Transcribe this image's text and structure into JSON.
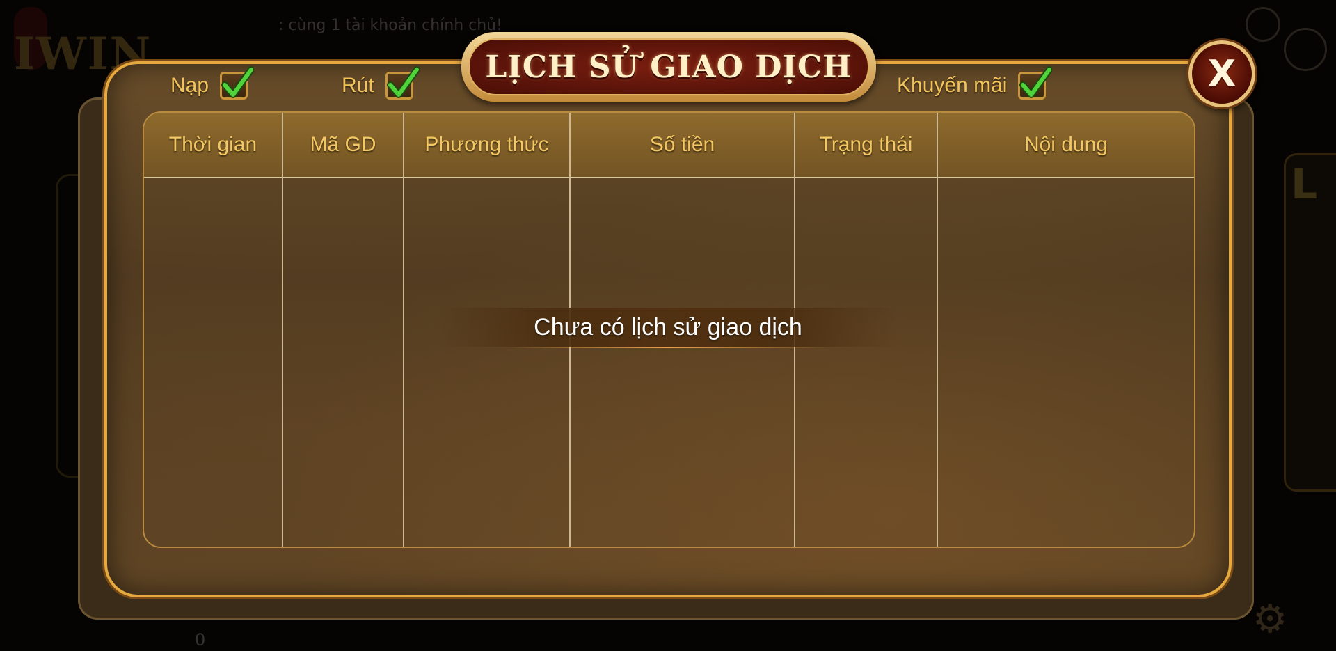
{
  "background": {
    "ticker_text": ": cùng 1 tài khoản chính chủ!",
    "logo_text": "IWIN",
    "side_text": "L",
    "bottom_value": "0"
  },
  "dialog": {
    "title": "LỊCH SỬ GIAO DỊCH",
    "close_label": "X",
    "filters": [
      {
        "label": "Nạp",
        "checked": true
      },
      {
        "label": "Rút",
        "checked": true
      },
      {
        "label": "Khuyến mãi",
        "checked": true
      }
    ],
    "columns": [
      "Thời gian",
      "Mã GD",
      "Phương thức",
      "Số tiền",
      "Trạng thái",
      "Nội dung"
    ],
    "rows": [],
    "empty_message": "Chưa có lịch sử giao dịch"
  },
  "colors": {
    "accent_gold": "#f1c35a",
    "title_red": "#7a1e10",
    "check_green": "#3fbf2e"
  },
  "icons": {
    "checkbox_mark": "checkmark-icon",
    "close": "close-icon",
    "settings": "gear-icon"
  }
}
